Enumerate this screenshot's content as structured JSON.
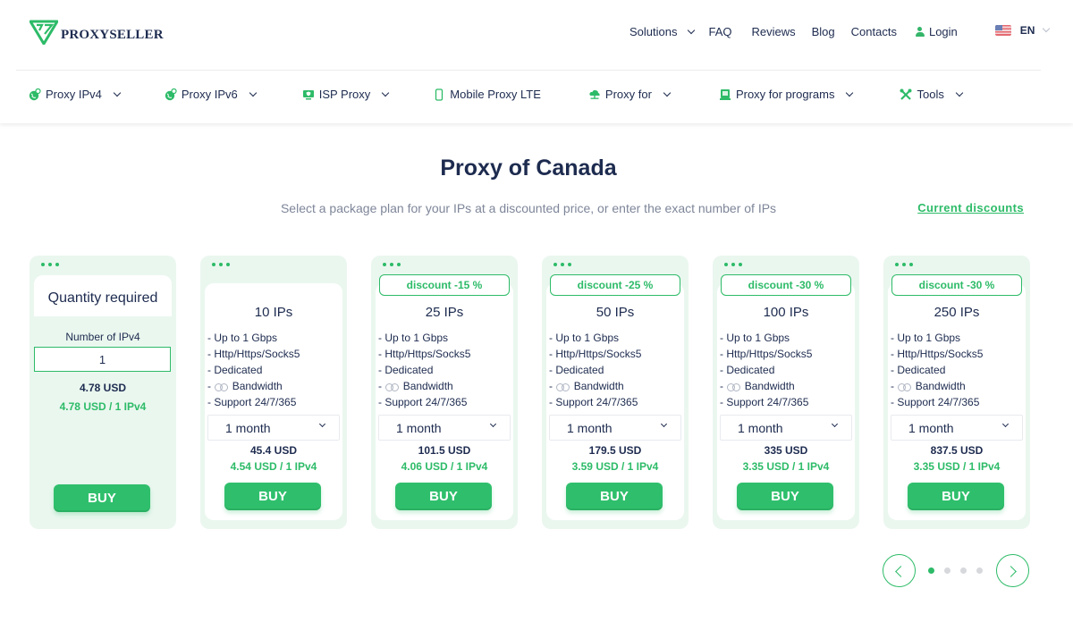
{
  "header": {
    "brand": "PROXYSELLER",
    "nav": [
      {
        "label": "Solutions",
        "has_dropdown": true
      },
      {
        "label": "FAQ"
      },
      {
        "label": "Reviews"
      },
      {
        "label": "Blog"
      },
      {
        "label": "Contacts"
      },
      {
        "label": "Login",
        "icon": "user-icon"
      }
    ],
    "language": {
      "code": "EN",
      "flag": "us-flag-icon"
    }
  },
  "subnav": [
    {
      "label": "Proxy IPv4",
      "icon": "globe-pin-icon",
      "has_dropdown": true
    },
    {
      "label": "Proxy IPv6",
      "icon": "globe-pin-icon",
      "has_dropdown": true
    },
    {
      "label": "ISP Proxy",
      "icon": "monitor-shield-icon",
      "has_dropdown": true
    },
    {
      "label": "Mobile Proxy LTE",
      "icon": "mobile-phone-icon",
      "has_dropdown": false
    },
    {
      "label": "Proxy for",
      "icon": "cloud-network-icon",
      "has_dropdown": true
    },
    {
      "label": "Proxy for programs",
      "icon": "app-window-icon",
      "has_dropdown": true
    },
    {
      "label": "Tools",
      "icon": "tools-icon",
      "has_dropdown": true
    }
  ],
  "main": {
    "title": "Proxy of Canada",
    "subtitle": "Select a package plan for your IPs at a discounted price, or enter the exact number of IPs",
    "discounts_link": "Current discounts"
  },
  "quantity_card": {
    "heading": "Quantity required",
    "input_label": "Number of IPv4",
    "input_value": "1",
    "price": "4.78 USD",
    "unit_price": "4.78 USD / 1 IPv4",
    "buy_label": "BUY"
  },
  "packages": [
    {
      "discount": null,
      "ips": "10 IPs",
      "period": "1 month",
      "price": "45.4 USD",
      "unit_price": "4.54 USD / 1 IPv4",
      "buy_label": "BUY"
    },
    {
      "discount": "discount -15 %",
      "ips": "25 IPs",
      "period": "1 month",
      "price": "101.5 USD",
      "unit_price": "4.06 USD / 1 IPv4",
      "buy_label": "BUY"
    },
    {
      "discount": "discount -25 %",
      "ips": "50 IPs",
      "period": "1 month",
      "price": "179.5 USD",
      "unit_price": "3.59 USD / 1 IPv4",
      "buy_label": "BUY"
    },
    {
      "discount": "discount -30 %",
      "ips": "100 IPs",
      "period": "1 month",
      "price": "335 USD",
      "unit_price": "3.35 USD / 1 IPv4",
      "buy_label": "BUY"
    },
    {
      "discount": "discount -30 %",
      "ips": "250 IPs",
      "period": "1 month",
      "price": "837.5 USD",
      "unit_price": "3.35 USD / 1 IPv4",
      "buy_label": "BUY"
    }
  ],
  "features": {
    "speed": "- Up to 1 Gbps",
    "protocols": "- Http/Https/Socks5",
    "type": "- Dedicated",
    "bandwidth_prefix": "-",
    "bandwidth": "Bandwidth",
    "support": "- Support 24/7/365"
  },
  "pager": {
    "total_pages": 4,
    "current_page": 1
  },
  "colors": {
    "accent": "#2dbb68",
    "text": "#1d2b4f",
    "card_bg": "#eaf7ef",
    "muted": "#7e8699"
  }
}
